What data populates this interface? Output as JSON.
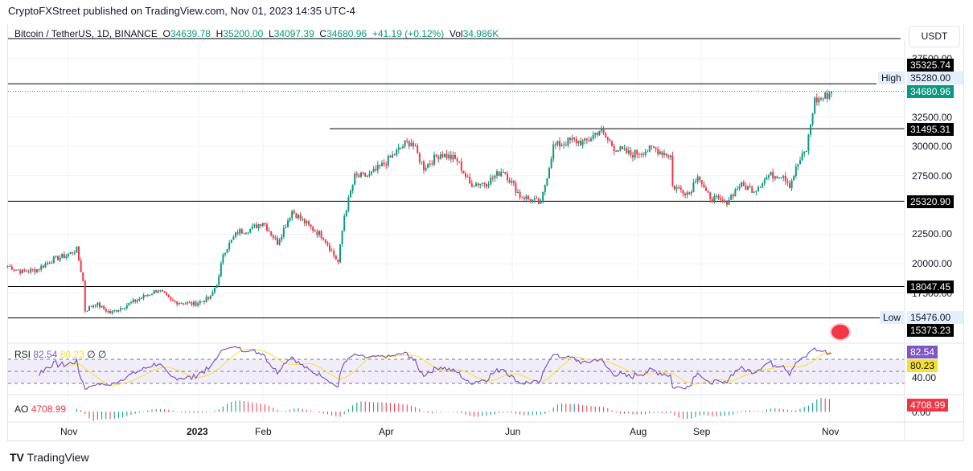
{
  "publish_line": "CryptoFXStreet published on TradingView.com, Nov 01, 2023 14:35 UTC-4",
  "legend": {
    "symbol": "Bitcoin / TetherUS, 1D, BINANCE",
    "o_label": "O",
    "o": "34639.78",
    "h_label": "H",
    "h": "35200.00",
    "l_label": "L",
    "l": "34097.39",
    "c_label": "C",
    "c": "34680.96",
    "change": "+41.19 (+0.12%)",
    "vol_label": "Vol",
    "vol": "34.986K"
  },
  "currency_button": "USDT",
  "price_ticks": [
    "37500.00",
    "32500.00",
    "30000.00",
    "27500.00",
    "22500.00",
    "20000.00",
    "17500.00"
  ],
  "level_labels": [
    "35325.74",
    "31495.31",
    "25320.90",
    "18047.45",
    "15373.23"
  ],
  "high_tag": {
    "label": "High",
    "value": "35280.00"
  },
  "low_tag": {
    "label": "Low",
    "value": "15476.00"
  },
  "last_price": "34680.96",
  "rsi": {
    "label": "RSI",
    "value": "82.54",
    "ma": "80.23",
    "extra1": "∅",
    "extra2": "∅",
    "axis": "40.00"
  },
  "ao": {
    "label": "AO",
    "value": "4708.99",
    "axis": "0.00"
  },
  "time_ticks": [
    "Nov",
    "2023",
    "Feb",
    "Apr",
    "Jun",
    "Aug",
    "Sep",
    "Nov"
  ],
  "brand": "TradingView",
  "colors": {
    "up": "#089981",
    "down": "#f23645",
    "rsi": "#7e57c2",
    "rsi_ma": "#f5e033"
  },
  "chart_data": {
    "type": "candlestick",
    "title": "Bitcoin / TetherUS, 1D, BINANCE",
    "ylim": [
      14000,
      38000
    ],
    "horizontal_levels": [
      35325.74,
      31495.31,
      25320.9,
      18047.45,
      15373.23
    ],
    "close_anchors": [
      [
        "2022-10-03",
        19800
      ],
      [
        "2022-10-10",
        19300
      ],
      [
        "2022-10-17",
        19500
      ],
      [
        "2022-10-24",
        20300
      ],
      [
        "2022-10-31",
        20700
      ],
      [
        "2022-11-05",
        21200
      ],
      [
        "2022-11-08",
        18500
      ],
      [
        "2022-11-09",
        16000
      ],
      [
        "2022-11-14",
        16600
      ],
      [
        "2022-11-21",
        15800
      ],
      [
        "2022-11-28",
        16400
      ],
      [
        "2022-12-05",
        17000
      ],
      [
        "2022-12-14",
        17800
      ],
      [
        "2022-12-20",
        16800
      ],
      [
        "2022-12-31",
        16550
      ],
      [
        "2023-01-08",
        17100
      ],
      [
        "2023-01-12",
        18800
      ],
      [
        "2023-01-14",
        20900
      ],
      [
        "2023-01-21",
        22700
      ],
      [
        "2023-01-28",
        23000
      ],
      [
        "2023-02-02",
        23600
      ],
      [
        "2023-02-09",
        21800
      ],
      [
        "2023-02-16",
        24500
      ],
      [
        "2023-02-24",
        23200
      ],
      [
        "2023-03-03",
        22300
      ],
      [
        "2023-03-10",
        20100
      ],
      [
        "2023-03-13",
        24100
      ],
      [
        "2023-03-18",
        27400
      ],
      [
        "2023-03-25",
        27500
      ],
      [
        "2023-04-01",
        28500
      ],
      [
        "2023-04-11",
        30200
      ],
      [
        "2023-04-14",
        30400
      ],
      [
        "2023-04-20",
        28200
      ],
      [
        "2023-04-28",
        29400
      ],
      [
        "2023-05-06",
        28800
      ],
      [
        "2023-05-12",
        26800
      ],
      [
        "2023-05-20",
        26900
      ],
      [
        "2023-05-28",
        28000
      ],
      [
        "2023-06-05",
        25800
      ],
      [
        "2023-06-15",
        25100
      ],
      [
        "2023-06-21",
        30000
      ],
      [
        "2023-06-30",
        30500
      ],
      [
        "2023-07-06",
        30300
      ],
      [
        "2023-07-13",
        31400
      ],
      [
        "2023-07-20",
        29900
      ],
      [
        "2023-07-28",
        29300
      ],
      [
        "2023-08-08",
        29800
      ],
      [
        "2023-08-16",
        29200
      ],
      [
        "2023-08-17",
        26600
      ],
      [
        "2023-08-25",
        26000
      ],
      [
        "2023-08-29",
        27700
      ],
      [
        "2023-09-02",
        25900
      ],
      [
        "2023-09-11",
        25100
      ],
      [
        "2023-09-18",
        26700
      ],
      [
        "2023-09-25",
        26300
      ],
      [
        "2023-10-02",
        27500
      ],
      [
        "2023-10-09",
        27600
      ],
      [
        "2023-10-12",
        26700
      ],
      [
        "2023-10-16",
        28500
      ],
      [
        "2023-10-20",
        29700
      ],
      [
        "2023-10-23",
        33000
      ],
      [
        "2023-10-24",
        33900
      ],
      [
        "2023-10-28",
        34100
      ],
      [
        "2023-11-01",
        34680.96
      ]
    ]
  }
}
